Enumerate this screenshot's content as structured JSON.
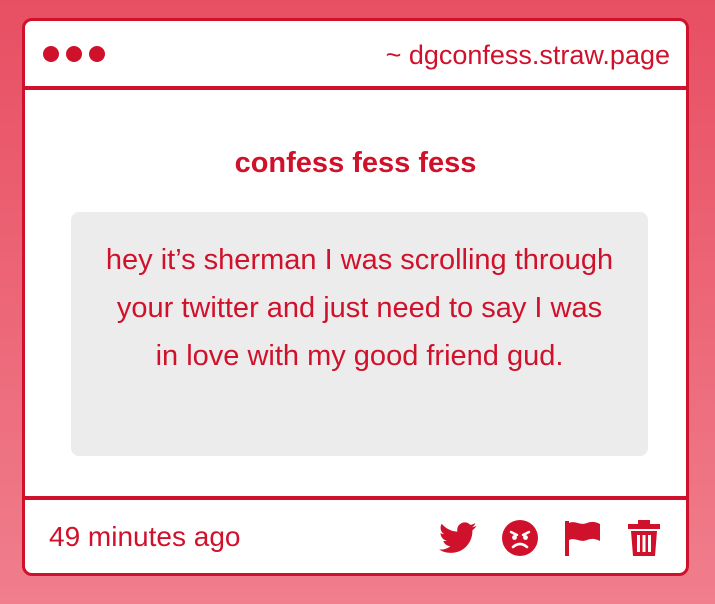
{
  "window": {
    "url": "~ dgconfess.straw.page"
  },
  "post": {
    "title": "confess fess fess",
    "message": "hey it’s sherman I was scrolling through your twitter and just need to say I was in love with my good friend gud.",
    "timestamp": "49 minutes ago"
  },
  "actions": [
    {
      "name": "twitter-icon"
    },
    {
      "name": "angry-face-icon"
    },
    {
      "name": "flag-icon"
    },
    {
      "name": "trash-icon"
    }
  ],
  "colors": {
    "accent": "#d0112b",
    "message_bg": "#edeced",
    "page_bg_top": "#e84f63",
    "page_bg_bottom": "#f07e8c"
  }
}
